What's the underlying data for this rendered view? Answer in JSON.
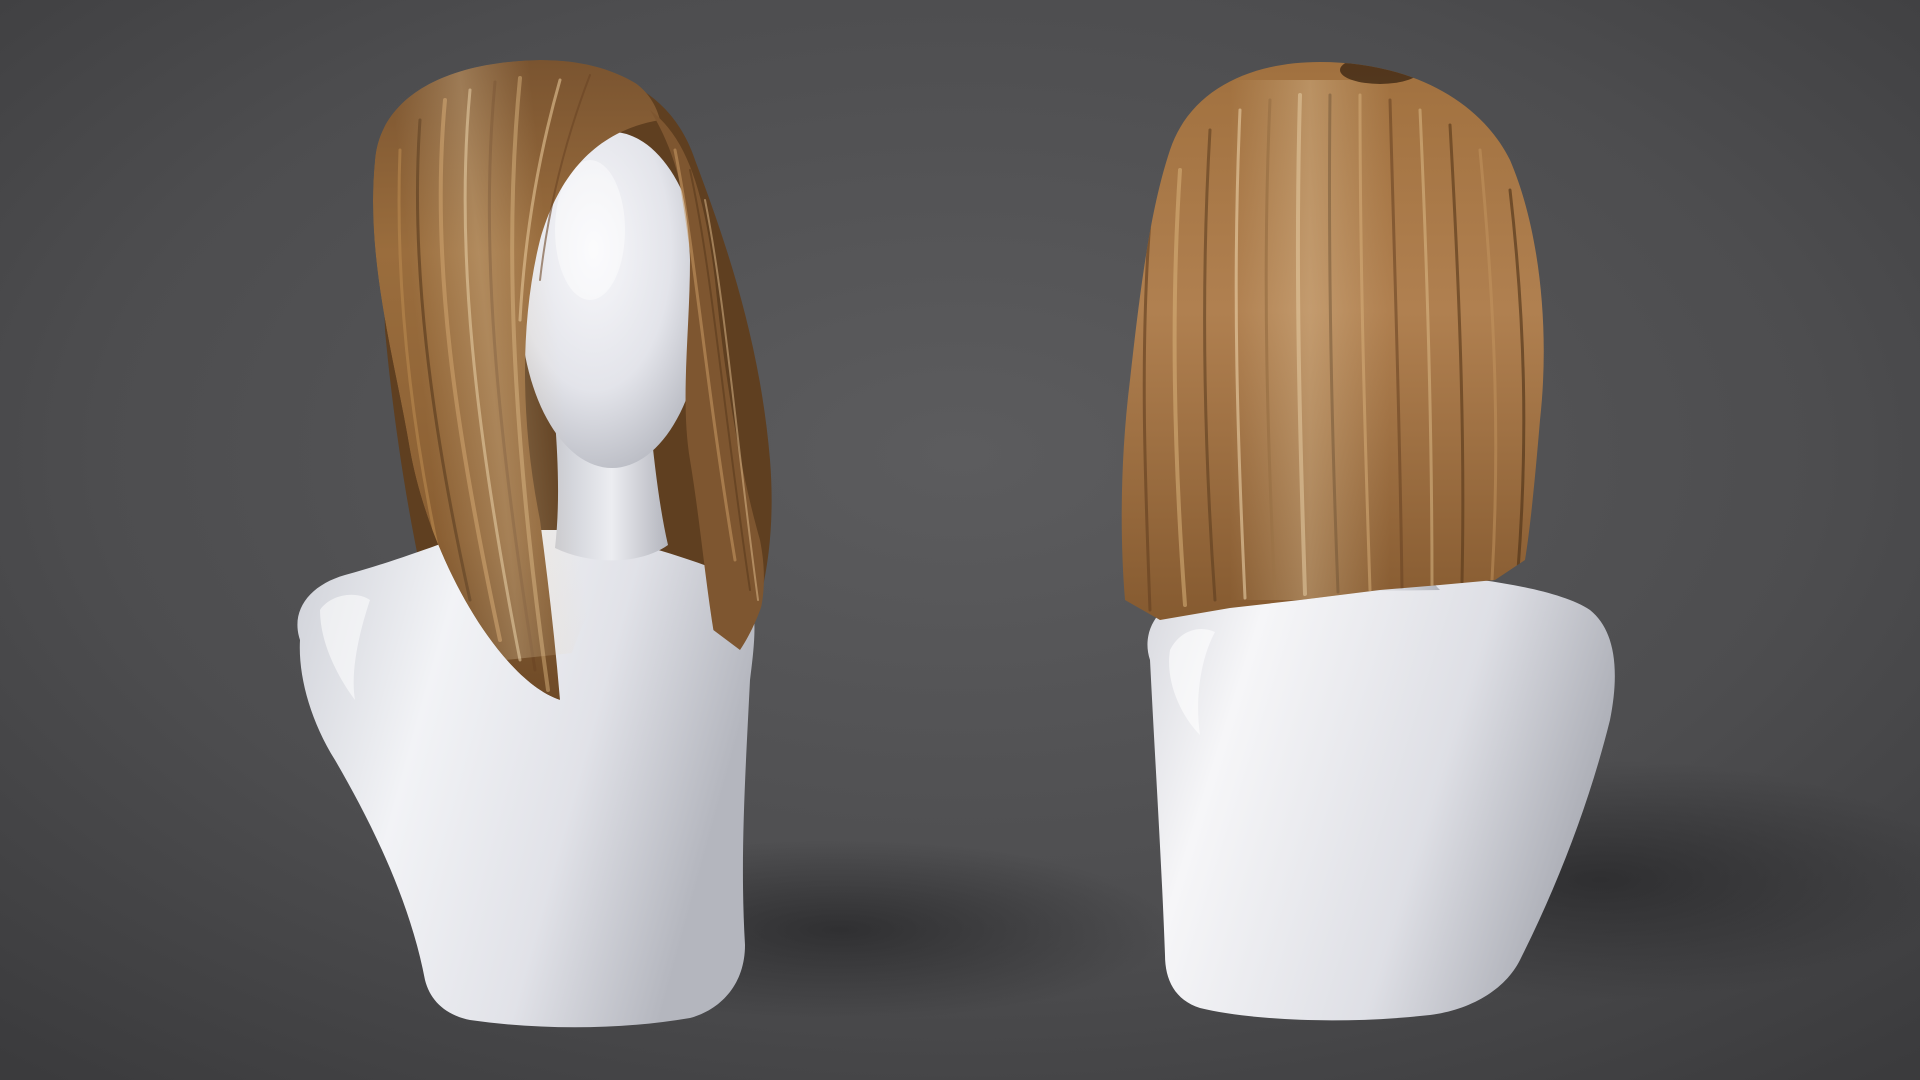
{
  "scene": {
    "subjects": [
      {
        "id": "front-view",
        "view": "front",
        "hair_style": "bob",
        "mannequin": "featureless"
      },
      {
        "id": "back-view",
        "view": "back",
        "hair_style": "bob",
        "mannequin": "featureless"
      }
    ]
  },
  "colors": {
    "background_top": "#3c3c3e",
    "background_center": "#5a5a5c",
    "background_bottom": "#444446",
    "floor_shadow": "#2e2e30",
    "hair_dark": "#5a3a1c",
    "hair_mid": "#8a5f33",
    "hair_light": "#b58752",
    "hair_highlight": "#e8cfa6",
    "mannequin_base": "#e6e7ec",
    "mannequin_shade": "#b9bbc3",
    "mannequin_highlight": "#ffffff"
  }
}
